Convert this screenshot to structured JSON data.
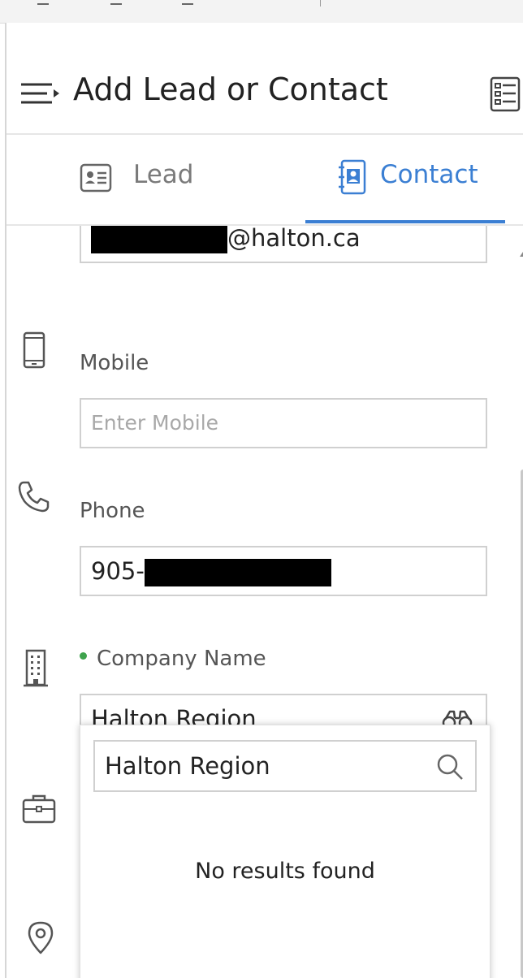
{
  "header": {
    "title": "Add Lead or Contact"
  },
  "tabs": [
    {
      "label": "Lead",
      "active": false
    },
    {
      "label": "Contact",
      "active": true
    }
  ],
  "form": {
    "email": {
      "value_visible": "@halton.ca"
    },
    "mobile": {
      "label": "Mobile",
      "placeholder": "Enter Mobile"
    },
    "phone": {
      "label": "Phone",
      "value_visible": "905-"
    },
    "company": {
      "label": "Company Name",
      "value": "Halton Region",
      "required": true
    }
  },
  "company_lookup": {
    "search_value": "Halton Region",
    "empty_message": "No results found"
  },
  "colors": {
    "accent": "#3b7fd3",
    "required_dot": "#3fa34d"
  }
}
